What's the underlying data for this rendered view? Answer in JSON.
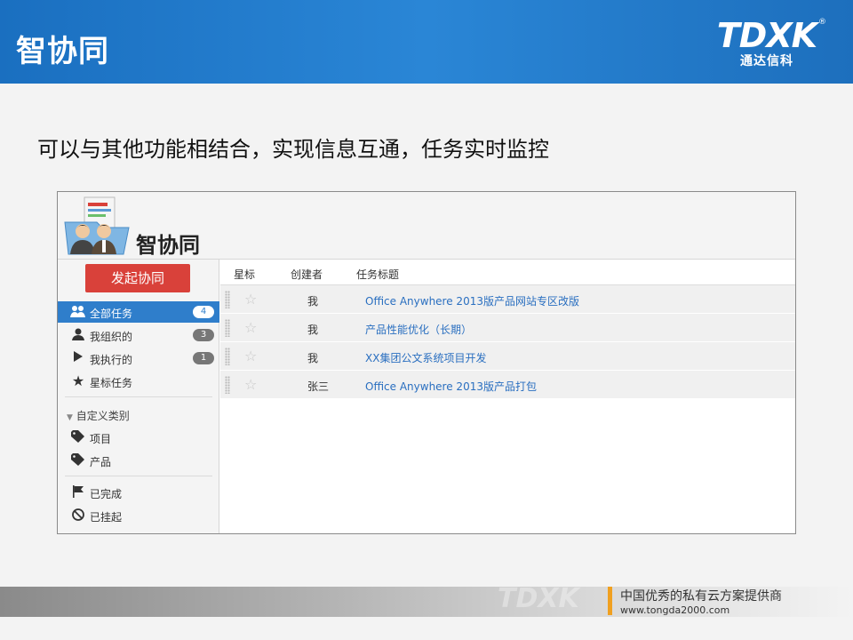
{
  "header": {
    "title": "智协同",
    "logo_mark": "TDXK",
    "logo_reg": "®",
    "logo_sub": "通达信科"
  },
  "subtitle": "可以与其他功能相结合，实现信息互通，任务实时监控",
  "app": {
    "name": "智协同",
    "launch_button": "发起协同",
    "nav": [
      {
        "label": "全部任务",
        "count": "4",
        "icon": "group-icon",
        "active": true
      },
      {
        "label": "我组织的",
        "count": "3",
        "icon": "user-icon"
      },
      {
        "label": "我执行的",
        "count": "1",
        "icon": "play-icon"
      },
      {
        "label": "星标任务",
        "icon": "star-icon"
      }
    ],
    "custom_group_label": "自定义类别",
    "custom_items": [
      {
        "label": "项目",
        "icon": "tag-icon"
      },
      {
        "label": "产品",
        "icon": "tag-icon"
      }
    ],
    "status_items": [
      {
        "label": "已完成",
        "icon": "flag-icon"
      },
      {
        "label": "已挂起",
        "icon": "ban-icon"
      }
    ],
    "table": {
      "columns": [
        "星标",
        "创建者",
        "任务标题"
      ],
      "rows": [
        {
          "creator": "我",
          "title": "Office Anywhere 2013版产品网站专区改版"
        },
        {
          "creator": "我",
          "title": "产品性能优化（长期）"
        },
        {
          "creator": "我",
          "title": "XX集团公文系统项目开发"
        },
        {
          "creator": "张三",
          "title": "Office Anywhere 2013版产品打包"
        }
      ]
    }
  },
  "footer": {
    "watermark": "TDXK",
    "slogan": "中国优秀的私有云方案提供商",
    "url": "www.tongda2000.com"
  },
  "colors": {
    "header_blue": "#1f78c8",
    "accent_red": "#d9413a",
    "active_blue": "#2f7ecb",
    "link_blue": "#2a6fc0",
    "footer_orange": "#f0a020"
  }
}
